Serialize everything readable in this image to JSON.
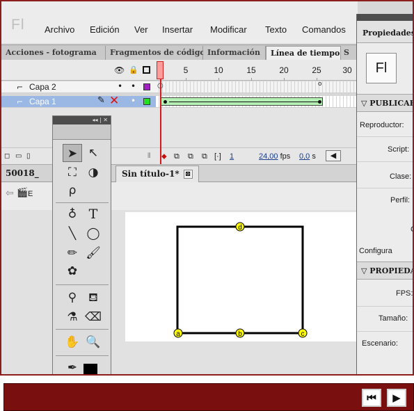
{
  "app": {
    "logo": "Fl"
  },
  "menu": [
    "Archivo",
    "Edición",
    "Ver",
    "Insertar",
    "Modificar",
    "Texto",
    "Comandos"
  ],
  "panel_tabs": [
    "Acciones - fotograma",
    "Fragmentos de código",
    "Información",
    "Línea de tiempo",
    "S"
  ],
  "timeline": {
    "header_icons": [
      "eye-icon",
      "lock-icon",
      "outline-icon"
    ],
    "frame_numbers": [
      "5",
      "10",
      "15",
      "20",
      "25",
      "30"
    ],
    "layers": [
      {
        "name": "Capa 2"
      },
      {
        "name": "Capa 1"
      }
    ],
    "layer2_keyframe_mark": "o",
    "status": {
      "current_frame": "1",
      "fps": "24,00",
      "fps_unit": "fps",
      "time": "0,0",
      "time_unit": "s"
    }
  },
  "document": {
    "left_tab": "50018_",
    "tab_title": "Sin título-1*",
    "close_glyph": "⊠",
    "scene_label": "E"
  },
  "properties": {
    "tab": "Propiedades",
    "logo": "Fl",
    "section_publish": "▽ PUBLICAR",
    "section_props": "▽ PROPIEDA",
    "labels": {
      "reproductor": "Reproductor:",
      "script": "Script:",
      "clase": "Clase:",
      "perfil": "Perfil:",
      "c": "C",
      "configura": "Configura",
      "fps": "FPS:",
      "tamano": "Tamaño:",
      "escenario": "Escenario:"
    }
  },
  "shape": {
    "points": {
      "a": "a",
      "b": "b",
      "c": "c",
      "d": "d"
    },
    "marker_color": "#ffff00"
  },
  "colors": {
    "accent_red": "#8b1d1d",
    "tween_green": "#b5f0b5",
    "playhead": "#d81818",
    "selected_layer": "#9ab8e3"
  }
}
